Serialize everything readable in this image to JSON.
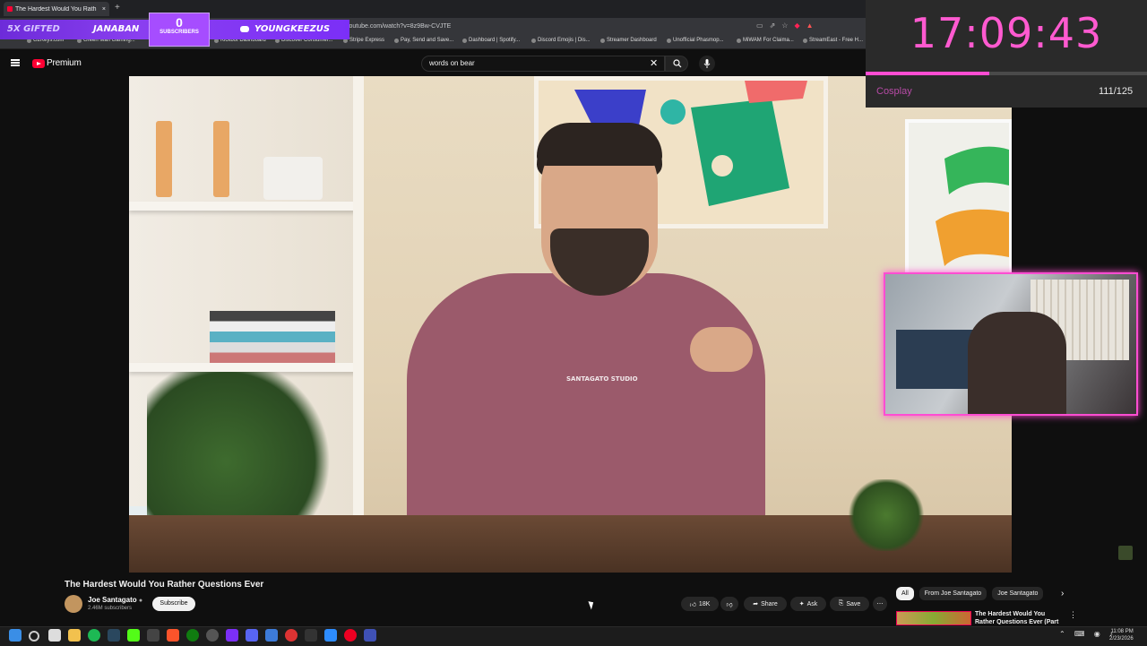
{
  "browser": {
    "tab_title": "The Hardest Would You Rath",
    "new_tab": "+",
    "url": "youtube.com/watch?v=8z9Bw-CVJTE",
    "bookmarks": [
      "G2Keys.com",
      "Green Man Gaming...",
      "Kickbot Dashboard",
      "Discover Consumer...",
      "Stripe Express",
      "Pay, Send and Save...",
      "Dashboard | Spotify...",
      "Discord Emojis | Dis...",
      "Streamer Dashboard",
      "Unofficial Phasmop...",
      "MiWAM For Claima...",
      "StreamEast - Free H..."
    ]
  },
  "stream_overlay": {
    "gifted": "5X GIFTED",
    "user": "JANABAN",
    "sub_count": "0",
    "sub_label": "SUBSCRIBERS",
    "discord_name": "YOUNGKEEZUS",
    "timer": "17:09:43",
    "timer_progress": 0.44,
    "category": "Cosplay",
    "count": "111/125"
  },
  "youtube": {
    "logo_text": "Premium",
    "search_value": "words on bear",
    "video": {
      "shirt_text": "SANTAGATO STUDIO",
      "title": "The Hardest Would You Rather Questions Ever",
      "channel": "Joe Santagato",
      "subscribers": "2.46M subscribers",
      "subscribe_label": "Subscribe",
      "likes": "18K",
      "share_label": "Share",
      "ask_label": "Ask",
      "save_label": "Save"
    },
    "chips": [
      "All",
      "From Joe Santagato",
      "Joe Santagato"
    ],
    "related_title": "The Hardest Would You Rather Questions Ever (Part 2)"
  },
  "system": {
    "time": "11:08 PM",
    "date": "2/23/2026"
  },
  "colors": {
    "accent_pink": "#ff4dd2",
    "overlay_purple": "#7b2ff7",
    "youtube_red": "#ff0033"
  }
}
